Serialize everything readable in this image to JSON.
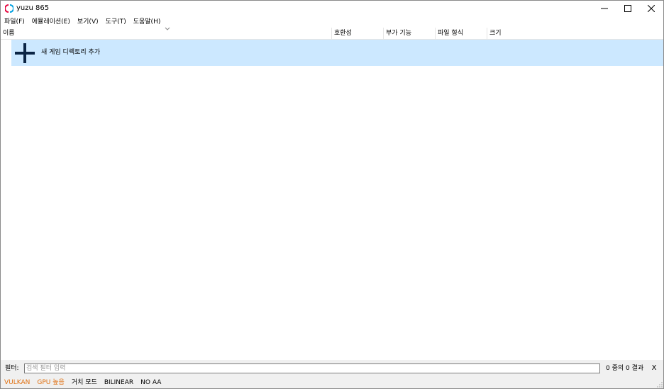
{
  "window": {
    "title": "yuzu 865",
    "controls": {
      "minimize": "−",
      "maximize": "□",
      "close": "✕"
    }
  },
  "menu": [
    {
      "label": "파일(F)"
    },
    {
      "label": "에뮬레이션(E)"
    },
    {
      "label": "보기(V)"
    },
    {
      "label": "도구(T)"
    },
    {
      "label": "도움말(H)"
    }
  ],
  "columns": [
    {
      "label": "이름"
    },
    {
      "label": "호환성"
    },
    {
      "label": "부가 기능"
    },
    {
      "label": "파일 형식"
    },
    {
      "label": "크기"
    }
  ],
  "game_list": {
    "add_directory_label": "새 게임 디렉토리 추가"
  },
  "filter": {
    "label": "필터:",
    "placeholder": "검색 필터 입력",
    "value": "",
    "result": "0 중의 0 결과",
    "clear_label": "X"
  },
  "status": [
    {
      "label": "VULKAN",
      "color": "#e07010"
    },
    {
      "label": "GPU 높음",
      "color": "#e07010"
    },
    {
      "label": "거치 모드",
      "color": "#000000"
    },
    {
      "label": "BILINEAR",
      "color": "#000000"
    },
    {
      "label": "NO AA",
      "color": "#000000"
    }
  ],
  "colors": {
    "selection": "#cce8ff",
    "plus_icon": "#0b2545",
    "logo_red": "#e4003a",
    "logo_blue": "#00a0e0"
  }
}
